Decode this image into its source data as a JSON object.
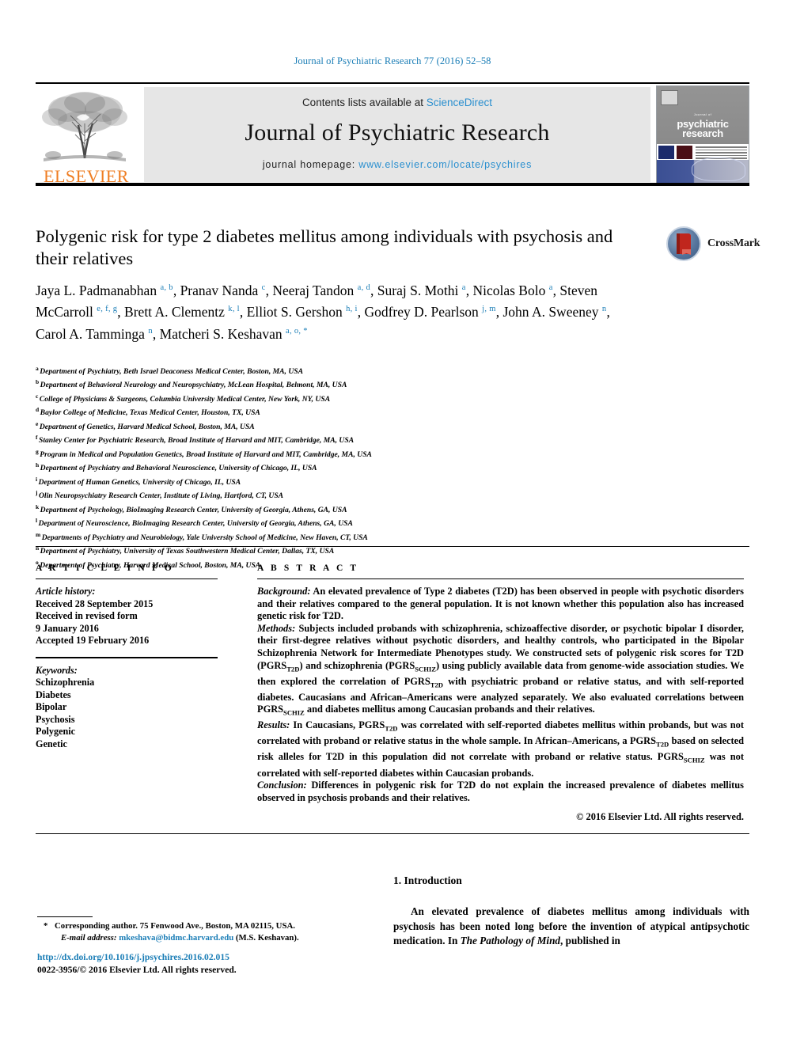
{
  "running_head": "Journal of Psychiatric Research 77 (2016) 52–58",
  "masthead": {
    "contents_prefix": "Contents lists available at ",
    "sciencedirect": "ScienceDirect",
    "journal_name": "Journal of Psychiatric Research",
    "homepage_prefix": "journal homepage: ",
    "homepage_url": "www.elsevier.com/locate/psychires",
    "publisher": "ELSEVIER",
    "cover_title_line1": "psychiatric",
    "cover_title_line2": "research",
    "cover_title_small": "Journal of"
  },
  "crossmark": {
    "label": "CrossMark"
  },
  "article": {
    "title": "Polygenic risk for type 2 diabetes mellitus among individuals with psychosis and their relatives",
    "authors": [
      {
        "name": "Jaya L. Padmanabhan",
        "sup": "a, b",
        "sep": ", "
      },
      {
        "name": "Pranav Nanda",
        "sup": "c",
        "sep": ", "
      },
      {
        "name": "Neeraj Tandon",
        "sup": "a, d",
        "sep": ", "
      },
      {
        "name": "Suraj S. Mothi",
        "sup": "a",
        "sep": ", "
      },
      {
        "name": "Nicolas Bolo",
        "sup": "a",
        "sep": ", "
      },
      {
        "name": "Steven McCarroll",
        "sup": "e, f, g",
        "sep": ", "
      },
      {
        "name": "Brett A. Clementz",
        "sup": "k, l",
        "sep": ", "
      },
      {
        "name": "Elliot S. Gershon",
        "sup": "h, i",
        "sep": ", "
      },
      {
        "name": "Godfrey D. Pearlson",
        "sup": "j, m",
        "sep": ", "
      },
      {
        "name": "John A. Sweeney",
        "sup": "n",
        "sep": ", "
      },
      {
        "name": "Carol A. Tamminga",
        "sup": "n",
        "sep": ", "
      },
      {
        "name": "Matcheri S. Keshavan",
        "sup": "a, o, *",
        "sep": ""
      }
    ],
    "affiliations": [
      {
        "mark": "a",
        "text": "Department of Psychiatry, Beth Israel Deaconess Medical Center, Boston, MA, USA"
      },
      {
        "mark": "b",
        "text": "Department of Behavioral Neurology and Neuropsychiatry, McLean Hospital, Belmont, MA, USA"
      },
      {
        "mark": "c",
        "text": "College of Physicians & Surgeons, Columbia University Medical Center, New York, NY, USA"
      },
      {
        "mark": "d",
        "text": "Baylor College of Medicine, Texas Medical Center, Houston, TX, USA"
      },
      {
        "mark": "e",
        "text": "Department of Genetics, Harvard Medical School, Boston, MA, USA"
      },
      {
        "mark": "f",
        "text": "Stanley Center for Psychiatric Research, Broad Institute of Harvard and MIT, Cambridge, MA, USA"
      },
      {
        "mark": "g",
        "text": "Program in Medical and Population Genetics, Broad Institute of Harvard and MIT, Cambridge, MA, USA"
      },
      {
        "mark": "h",
        "text": "Department of Psychiatry and Behavioral Neuroscience, University of Chicago, IL, USA"
      },
      {
        "mark": "i",
        "text": "Department of Human Genetics, University of Chicago, IL, USA"
      },
      {
        "mark": "j",
        "text": "Olin Neuropsychiatry Research Center, Institute of Living, Hartford, CT, USA"
      },
      {
        "mark": "k",
        "text": "Department of Psychology, BioImaging Research Center, University of Georgia, Athens, GA, USA"
      },
      {
        "mark": "l",
        "text": "Department of Neuroscience, BioImaging Research Center, University of Georgia, Athens, GA, USA"
      },
      {
        "mark": "m",
        "text": "Departments of Psychiatry and Neurobiology, Yale University School of Medicine, New Haven, CT, USA"
      },
      {
        "mark": "n",
        "text": "Department of Psychiatry, University of Texas Southwestern Medical Center, Dallas, TX, USA"
      },
      {
        "mark": "o",
        "text": "Department of Psychiatry, Harvard Medical School, Boston, MA, USA"
      }
    ]
  },
  "article_info": {
    "heading": "A R T I C L E   I N F O",
    "history_label": "Article history:",
    "history": [
      "Received 28 September 2015",
      "Received in revised form",
      "9 January 2016",
      "Accepted 19 February 2016"
    ],
    "keywords_label": "Keywords:",
    "keywords": [
      "Schizophrenia",
      "Diabetes",
      "Bipolar",
      "Psychosis",
      "Polygenic",
      "Genetic"
    ]
  },
  "abstract": {
    "heading": "A B S T R A C T",
    "background_label": "Background:",
    "background_text": " An elevated prevalence of Type 2 diabetes (T2D) has been observed in people with psychotic disorders and their relatives compared to the general population. It is not known whether this population also has increased genetic risk for T2D.",
    "methods_label": "Methods:",
    "methods_text_1": " Subjects included probands with schizophrenia, schizoaffective disorder, or psychotic bipolar I disorder, their first-degree relatives without psychotic disorders, and healthy controls, who participated in the Bipolar Schizophrenia Network for Intermediate Phenotypes study. We constructed sets of polygenic risk scores for T2D (PGRS",
    "methods_sub_1": "T2D",
    "methods_text_2": ") and schizophrenia (PGRS",
    "methods_sub_2": "SCHIZ",
    "methods_text_3": ") using publicly available data from genome-wide association studies. We then explored the correlation of PGRS",
    "methods_sub_3": "T2D",
    "methods_text_4": " with psychiatric proband or relative status, and with self-reported diabetes. Caucasians and African–Americans were analyzed separately. We also evaluated correlations between PGRS",
    "methods_sub_4": "SCHIZ",
    "methods_text_5": " and diabetes mellitus among Caucasian probands and their relatives.",
    "results_label": "Results:",
    "results_text_1": " In Caucasians, PGRS",
    "results_sub_1": "T2D",
    "results_text_2": " was correlated with self-reported diabetes mellitus within probands, but was not correlated with proband or relative status in the whole sample. In African–Americans, a PGRS",
    "results_sub_2": "T2D",
    "results_text_3": " based on selected risk alleles for T2D in this population did not correlate with proband or relative status. PGRS",
    "results_sub_3": "SCHIZ",
    "results_text_4": " was not correlated with self-reported diabetes within Caucasian probands.",
    "conclusion_label": "Conclusion:",
    "conclusion_text": " Differences in polygenic risk for T2D do not explain the increased prevalence of diabetes mellitus observed in psychosis probands and their relatives.",
    "copyright": "© 2016 Elsevier Ltd. All rights reserved."
  },
  "introduction": {
    "heading": "1. Introduction",
    "paragraph_part1": "An elevated prevalence of diabetes mellitus among individuals with psychosis has been noted long before the invention of atypical antipsychotic medication. In ",
    "paragraph_italic": "The Pathology of Mind",
    "paragraph_part2": ", published in"
  },
  "footnote": {
    "star": "*",
    "corresponding": "Corresponding author. 75 Fenwood Ave., Boston, MA 02115, USA.",
    "email_label": "E-mail address:",
    "email": "mkeshava@bidmc.harvard.edu",
    "email_owner": " (M.S. Keshavan)."
  },
  "footer": {
    "doi": "http://dx.doi.org/10.1016/j.jpsychires.2016.02.015",
    "issn_line": "0022-3956/© 2016 Elsevier Ltd. All rights reserved."
  },
  "colors": {
    "link_blue": "#1a7db6",
    "elsevier_orange": "#ef7d22",
    "sciencedirect_blue": "#2a8fcf"
  }
}
